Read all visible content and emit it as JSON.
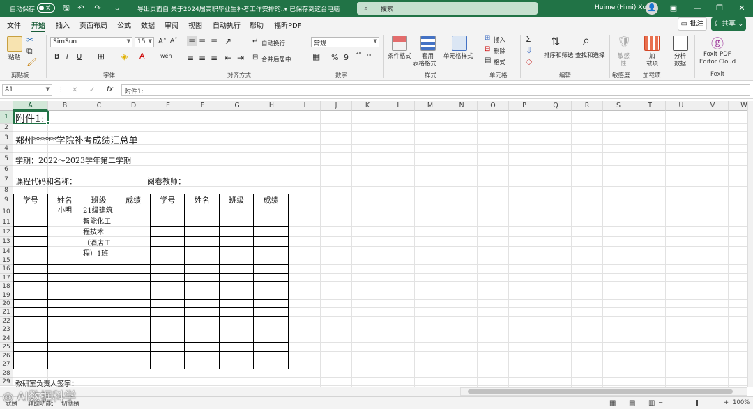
{
  "titlebar": {
    "autosave_label": "自动保存",
    "autosave_state": "关",
    "document_title": "导出页面自 关于2024届高职毕业生补考工作安排的...",
    "save_status": "• 已保存到这台电脑",
    "search_placeholder": "搜索",
    "user_name": "Huimei(Himi) Xu"
  },
  "menu": {
    "tabs": [
      "文件",
      "开始",
      "插入",
      "页面布局",
      "公式",
      "数据",
      "审阅",
      "视图",
      "自动执行",
      "帮助",
      "福昕PDF"
    ],
    "active_tab": "开始",
    "comments_label": "批注",
    "share_label": "共享"
  },
  "ribbon": {
    "clipboard": {
      "paste": "粘贴",
      "group": "剪贴板"
    },
    "font": {
      "name": "SimSun",
      "size": "15",
      "bold": "B",
      "italic": "I",
      "underline": "U",
      "grow": "A˄",
      "shrink": "A˅",
      "wen": "wén",
      "group": "字体"
    },
    "alignment": {
      "wrap": "自动换行",
      "merge": "合并后居中",
      "group": "对齐方式"
    },
    "number": {
      "format": "常规",
      "percent": "%",
      "comma": "9",
      "group": "数字"
    },
    "styles": {
      "conditional": "条件格式",
      "table_line1": "套用",
      "table_line2": "表格格式",
      "cell_styles": "单元格样式",
      "group": "样式"
    },
    "cells": {
      "insert": "插入",
      "delete": "删除",
      "format": "格式",
      "group": "单元格"
    },
    "editing": {
      "sort": "排序和筛选",
      "find": "查找和选择",
      "group": "编辑"
    },
    "sensitivity": {
      "label": "敏感度",
      "line1": "敏感",
      "line2": "性",
      "group": "敏感度"
    },
    "addins": {
      "line1": "加",
      "line2": "载项",
      "group": "加载项"
    },
    "analyze": {
      "line1": "分析",
      "line2": "数据"
    },
    "foxit": {
      "line1": "Foxit PDF",
      "line2": "Editor Cloud",
      "group": "Foxit"
    }
  },
  "formula_bar": {
    "name_box": "A1",
    "cancel": "✕",
    "enter": "✓",
    "fx": "fx",
    "formula": "附件1:"
  },
  "sheet": {
    "columns": [
      "A",
      "B",
      "C",
      "D",
      "E",
      "F",
      "G",
      "H",
      "I",
      "J",
      "K",
      "L",
      "M",
      "N",
      "O",
      "P",
      "Q",
      "R",
      "S",
      "T",
      "U",
      "V",
      "W"
    ],
    "rows": [
      "1",
      "2",
      "3",
      "4",
      "5",
      "6",
      "7",
      "8",
      "9",
      "10",
      "11",
      "12",
      "13",
      "14",
      "15",
      "16",
      "17",
      "18",
      "19",
      "20",
      "21",
      "22",
      "23",
      "24",
      "25",
      "26",
      "27",
      "28",
      "29"
    ],
    "selected_cell": "A1",
    "a1": "附件1:",
    "a3": "郑州*****学院补考成绩汇总单",
    "a5": "学期：2022～2023学年第二学期",
    "a7": "课程代码和名称：",
    "e7": "阅卷教师：",
    "header": [
      "学号",
      "姓名",
      "班级",
      "成绩",
      "学号",
      "姓名",
      "班级",
      "成绩"
    ],
    "b10": "小明",
    "c10_lines": [
      "21级建筑",
      "智能化工",
      "程技术",
      "（酒店工",
      "程）1班"
    ],
    "a29": "教研室负责人签字："
  },
  "status": {
    "ready": "就绪",
    "accessibility": "辅助功能: 一切就绪",
    "zoom": "100%"
  },
  "watermark": "AI数据科学"
}
